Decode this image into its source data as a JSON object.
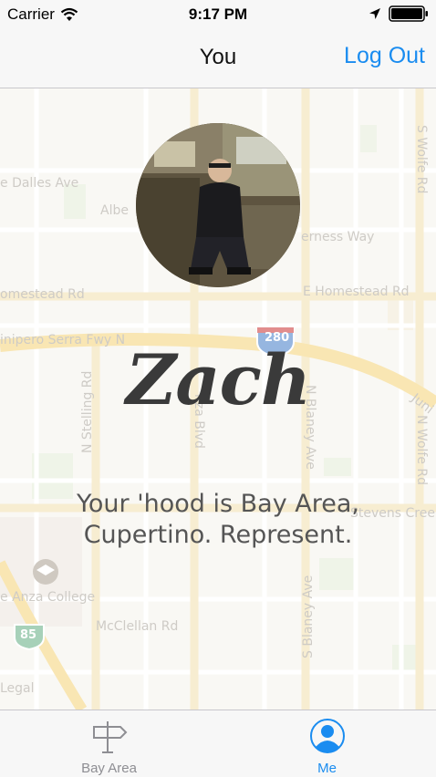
{
  "status_bar": {
    "carrier": "Carrier",
    "time": "9:17 PM"
  },
  "nav": {
    "title": "You",
    "logout_label": "Log Out"
  },
  "profile": {
    "name": "Zach",
    "hood_text": "Your 'hood is Bay Area, Cupertino. Represent."
  },
  "map": {
    "labels": {
      "dalles": "e Dalles Ave",
      "albe": "Albe",
      "erness": "erness Way",
      "homestead_w": "omestead Rd",
      "homestead_e": "E Homestead Rd",
      "junipero": "inipero Serra Fwy N",
      "shield_280": "280",
      "stelling": "N Stelling Rd",
      "anza_blvd": "nza Blvd",
      "n_blaney": "N Blaney Ave",
      "n_wolfe": "N Wolfe Rd",
      "s_wolfe": "S Wolfe Rd",
      "juni": "Juni",
      "stevens": "Stevens Creek",
      "anza_college": "e Anza College",
      "mcclellan": "McClellan Rd",
      "s_blaney": "S Blaney Ave",
      "shield_85": "85",
      "legal": "Legal"
    }
  },
  "tabs": [
    {
      "label": "Bay Area"
    },
    {
      "label": "Me"
    }
  ],
  "colors": {
    "accent": "#1a8cf0",
    "inactive": "#8e8e93"
  }
}
